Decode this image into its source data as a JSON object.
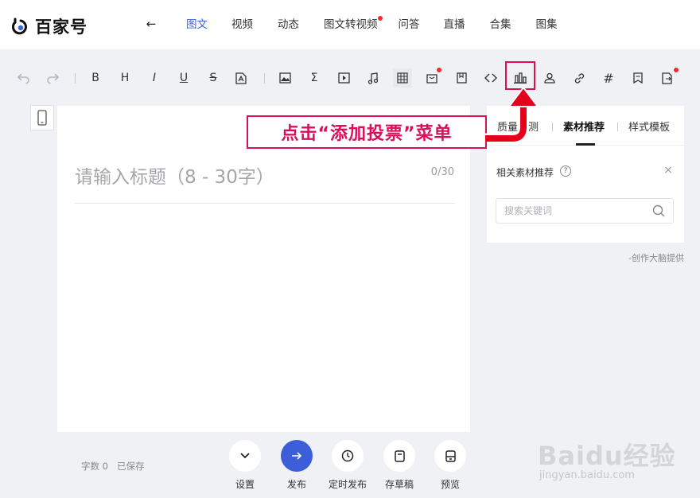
{
  "app": {
    "logo_text": "百家号"
  },
  "nav": {
    "tabs": [
      {
        "label": "图文",
        "active": true
      },
      {
        "label": "视频"
      },
      {
        "label": "动态"
      },
      {
        "label": "图文转视频",
        "dot": true
      },
      {
        "label": "问答"
      },
      {
        "label": "直播"
      },
      {
        "label": "合集"
      },
      {
        "label": "图集"
      }
    ]
  },
  "toolbar": {
    "bold": "B",
    "heading": "H",
    "italic": "I",
    "underline": "U",
    "strike": "S",
    "hash": "#",
    "sigma": "Σ"
  },
  "editor": {
    "title_placeholder": "请输入标题（8 - 30字）",
    "title_counter": "0/30"
  },
  "panel": {
    "tabs": [
      "质量检测",
      "素材推荐",
      "样式模板"
    ],
    "active_tab": "素材推荐",
    "rec_label": "相关素材推荐",
    "close": "×",
    "help": "?",
    "search_placeholder": "搜索关键词",
    "powered_by": "-创作大脑提供"
  },
  "callout": {
    "text": "点击“添加投票”菜单"
  },
  "bottom": {
    "word_count": "字数 0",
    "save_status": "已保存",
    "actions": [
      {
        "label": "设置",
        "icon": "chevron-down-icon"
      },
      {
        "label": "发布",
        "icon": "arrow-right-icon"
      },
      {
        "label": "定时发布",
        "icon": "clock-icon"
      },
      {
        "label": "存草稿",
        "icon": "draft-icon"
      },
      {
        "label": "预览",
        "icon": "preview-icon"
      }
    ]
  },
  "watermark": {
    "main": "Baidu经验",
    "sub": "jingyan.baidu.com"
  },
  "colors": {
    "accent": "#3b64d8",
    "callout": "#d8105a",
    "badge": "#ee2d2d"
  }
}
